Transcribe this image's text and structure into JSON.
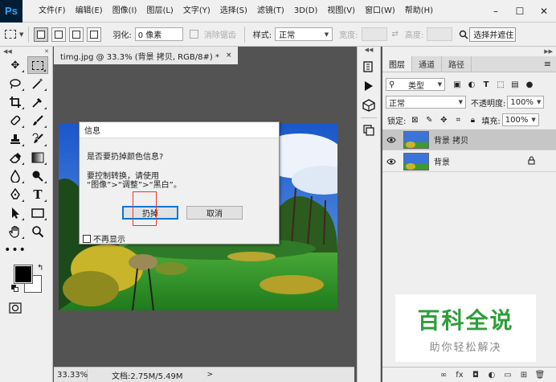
{
  "app": {
    "logo": "Ps",
    "menu": [
      "文件(F)",
      "编辑(E)",
      "图像(I)",
      "图层(L)",
      "文字(Y)",
      "选择(S)",
      "滤镜(T)",
      "3D(D)",
      "视图(V)",
      "窗口(W)",
      "帮助(H)"
    ],
    "window_controls": [
      "–",
      "☐",
      "✕"
    ]
  },
  "options": {
    "feather_label": "羽化:",
    "feather_value": "0 像素",
    "antialias_label": "消除锯齿",
    "style_label": "样式:",
    "style_value": "正常",
    "width_label": "宽度:",
    "height_label": "高度:",
    "select_mask_button": "选择并遮住"
  },
  "document": {
    "tab_title": "timg.jpg @ 33.3% (背景 拷贝, RGB/8#) *",
    "tab_close": "×"
  },
  "status": {
    "zoom": "33.33%",
    "doc_info": "文档:2.75M/5.49M",
    "arrow": ">"
  },
  "dialog": {
    "title": "信息",
    "question": "是否要扔掉颜色信息?",
    "desc_line1": "要控制转换，请使用",
    "desc_line2": "“图像”>“调整”>“黑白”。",
    "discard_button": "扔掉",
    "cancel_button": "取消",
    "dont_show_label": "不再显示"
  },
  "layers_panel": {
    "tabs": [
      "图层",
      "通道",
      "路径"
    ],
    "filter_value": "类型",
    "blend_mode": "正常",
    "opacity_label": "不透明度:",
    "opacity_value": "100%",
    "lock_label": "锁定:",
    "fill_label": "填充:",
    "fill_value": "100%",
    "layers": [
      {
        "name": "背景 拷贝"
      },
      {
        "name": "背景"
      }
    ],
    "bottom_icons": [
      "∞",
      "fx",
      "◘",
      "◐",
      "▭",
      "⊞",
      "🗑"
    ]
  },
  "watermark": {
    "title": "百科全说",
    "subtitle": "助你轻松解决"
  },
  "colors": {
    "accent": "#0078d7",
    "highlight": "#e53935",
    "watermark_green": "#2e9e3a"
  }
}
